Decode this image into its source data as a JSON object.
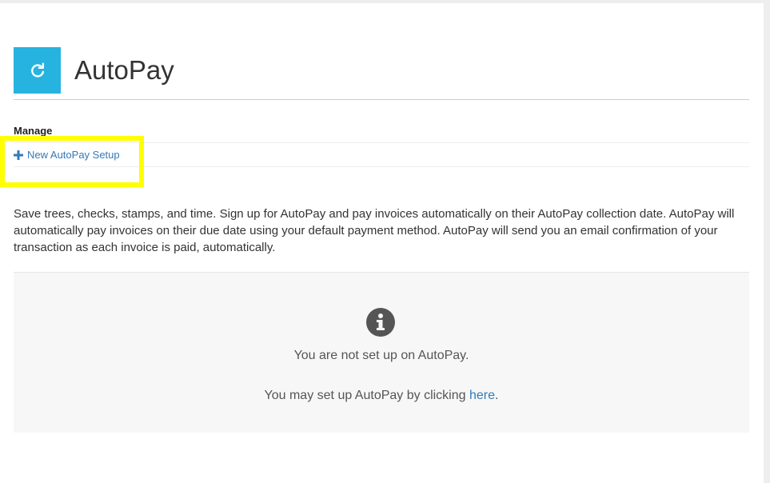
{
  "header": {
    "title": "AutoPay",
    "icon": "refresh-icon",
    "icon_bg": "#27b3e0"
  },
  "manage": {
    "heading": "Manage",
    "new_setup_label": "New AutoPay Setup",
    "new_setup_icon": "plus-icon"
  },
  "description": "Save trees, checks, stamps, and time. Sign up for AutoPay and pay invoices automatically on their AutoPay collection date. AutoPay will automatically pay invoices on their due date using your default payment method. AutoPay will send you an email confirmation of your transaction as each invoice is paid, automatically.",
  "info_panel": {
    "icon": "info-circle-icon",
    "not_setup_text": "You are not set up on AutoPay.",
    "may_setup_prefix": "You may set up AutoPay by clicking ",
    "here_link": "here",
    "may_setup_suffix": "."
  },
  "colors": {
    "link": "#337ab7",
    "highlight": "#ffff00"
  }
}
